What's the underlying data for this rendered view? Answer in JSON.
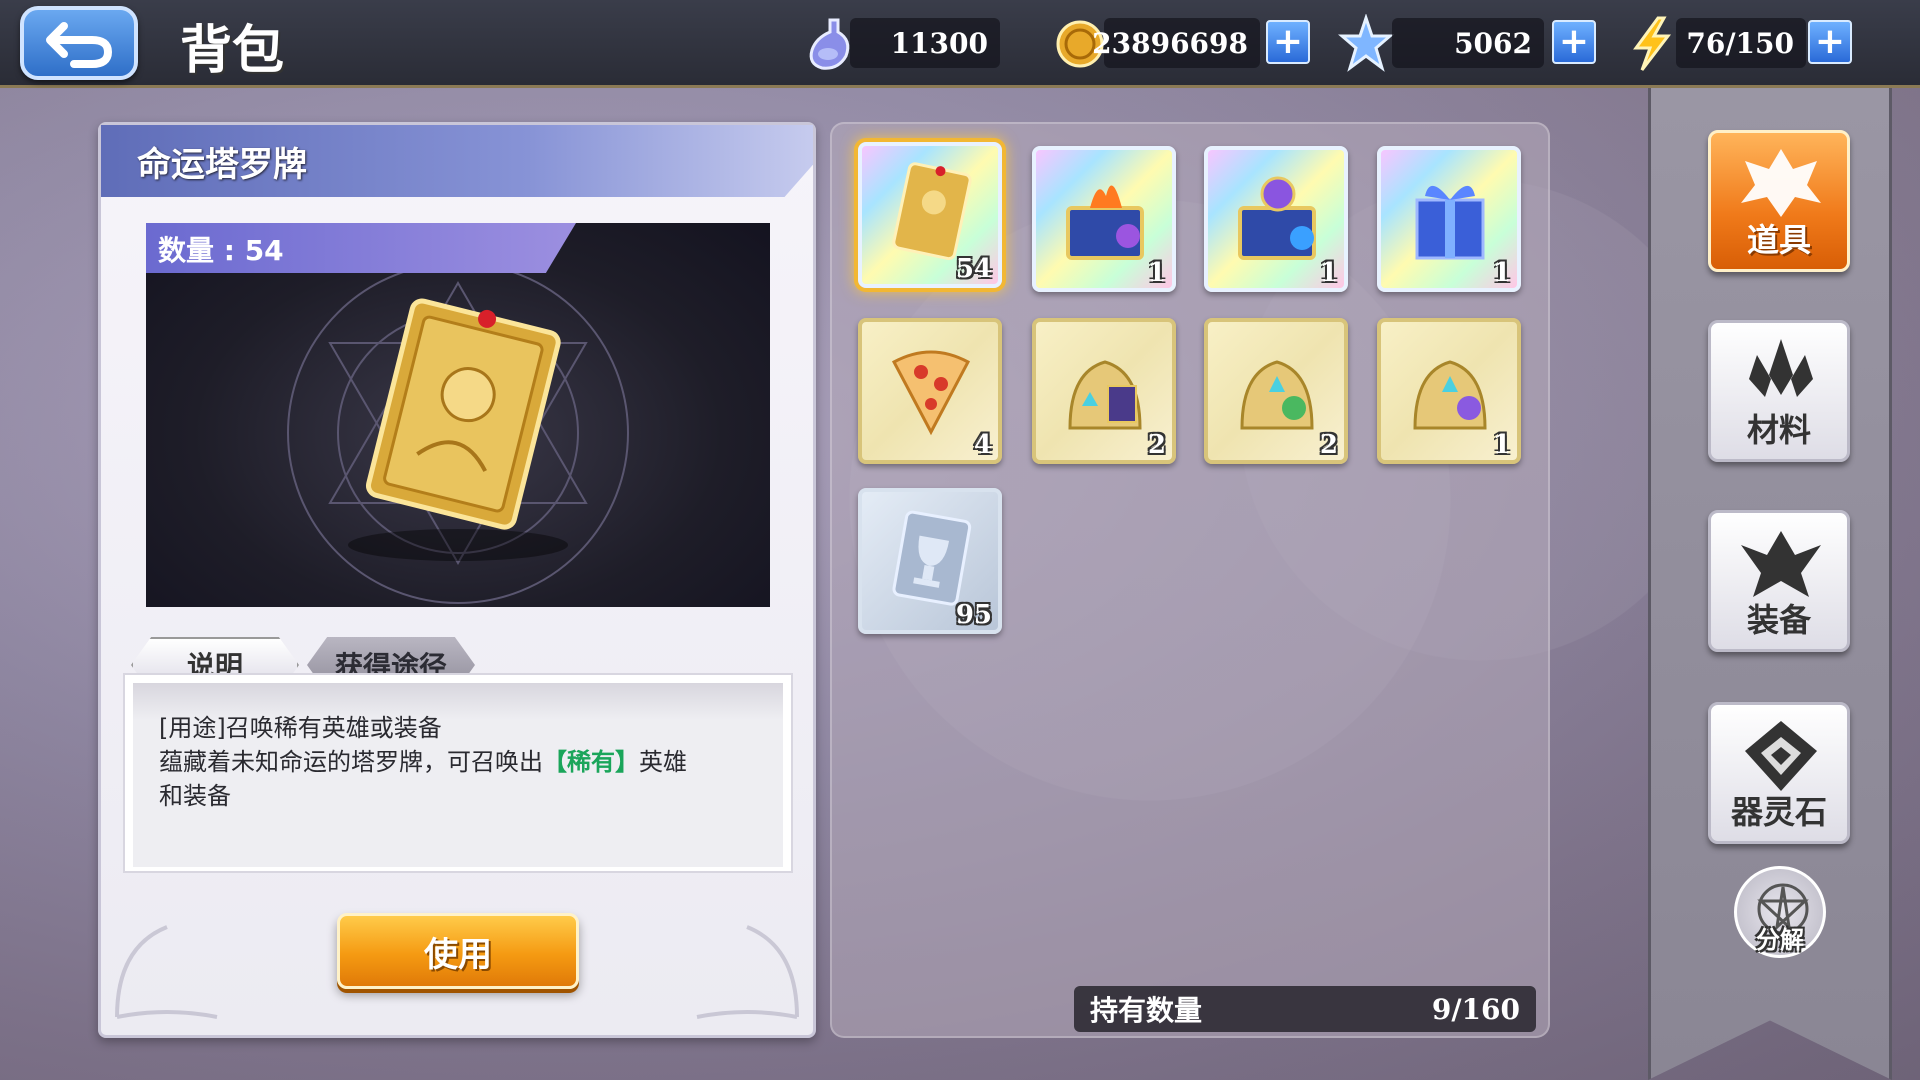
{
  "header": {
    "title": "背包",
    "currencies": [
      {
        "icon": "potion-icon",
        "value": "11300"
      },
      {
        "icon": "gold-coin-icon",
        "value": "23896698"
      },
      {
        "icon": "star-crystal-icon",
        "value": "5062"
      },
      {
        "icon": "lightning-icon",
        "value": "76/150"
      }
    ],
    "plus_label": "+"
  },
  "detail": {
    "item_name": "命运塔罗牌",
    "count_label": "数量 : 54",
    "tabs": [
      "说明",
      "获得途径"
    ],
    "desc_line1": "[用途]召唤稀有英雄或装备",
    "desc_line2_pre": "蕴藏着未知命运的塔罗牌，可召唤出",
    "desc_highlight": "【稀有】",
    "desc_line2_post": "英雄",
    "desc_line3": "和装备",
    "use_button": "使用"
  },
  "inventory": {
    "items": [
      {
        "name": "tarot-card",
        "count": "54",
        "frame": "rainbow",
        "selected": true
      },
      {
        "name": "flame-chest",
        "count": "1",
        "frame": "rainbow"
      },
      {
        "name": "orb-chest",
        "count": "1",
        "frame": "rainbow"
      },
      {
        "name": "gift-box",
        "count": "1",
        "frame": "rainbow"
      },
      {
        "name": "pizza-slice",
        "count": "4",
        "frame": "gold"
      },
      {
        "name": "lantern-pack-a",
        "count": "2",
        "frame": "gold"
      },
      {
        "name": "lantern-pack-b",
        "count": "2",
        "frame": "gold"
      },
      {
        "name": "lantern-pack-c",
        "count": "1",
        "frame": "gold"
      },
      {
        "name": "trophy-card",
        "count": "95",
        "frame": "silver"
      }
    ],
    "hold_label": "持有数量",
    "hold_value": "9/160"
  },
  "categories": [
    {
      "label": "道具",
      "icon": "props-icon",
      "active": true
    },
    {
      "label": "材料",
      "icon": "materials-icon",
      "active": false
    },
    {
      "label": "装备",
      "icon": "equipment-icon",
      "active": false
    },
    {
      "label": "器灵石",
      "icon": "spirit-stone-icon",
      "active": false
    }
  ],
  "disassemble_label": "分解",
  "colors": {
    "accent_orange": "#f07a1a",
    "highlight_green": "#1aa55a",
    "back_blue": "#2f6fc8"
  }
}
